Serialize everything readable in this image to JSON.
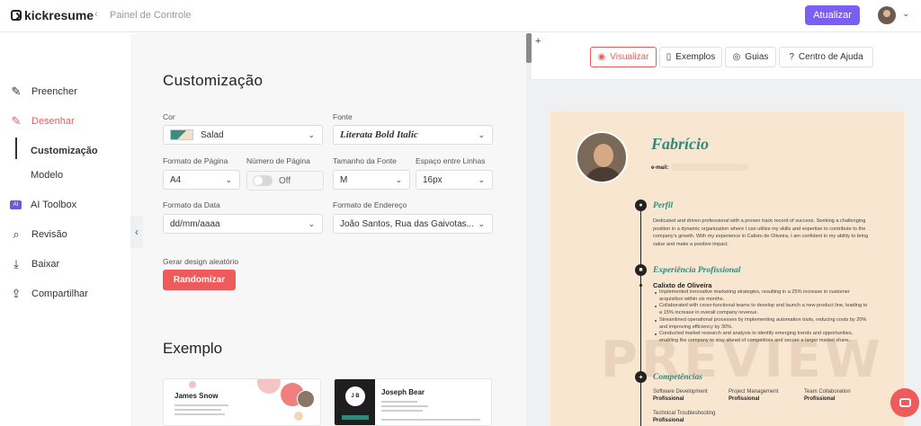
{
  "app": {
    "brand": "kickresume",
    "breadcrumb": "Painel de Controle",
    "back_icon": "chevron-left",
    "upgrade_label": "Atualizar"
  },
  "sidebar": {
    "items": [
      {
        "label": "Preencher",
        "icon": "pencil-icon"
      },
      {
        "label": "Desenhar",
        "icon": "edit-box-icon"
      },
      {
        "label": "AI Toolbox",
        "icon": "ai-badge-icon",
        "badge": "AI"
      },
      {
        "label": "Revisão",
        "icon": "review-icon"
      },
      {
        "label": "Baixar",
        "icon": "download-icon"
      },
      {
        "label": "Compartilhar",
        "icon": "share-icon"
      }
    ],
    "subitems": [
      {
        "label": "Customização"
      },
      {
        "label": "Modelo"
      }
    ]
  },
  "customize": {
    "title": "Customização",
    "color_label": "Cor",
    "color_value": "Salad",
    "font_label": "Fonte",
    "font_value": "Literata Bold Italic",
    "page_format_label": "Formato de Página",
    "page_format_value": "A4",
    "page_number_label": "Número de Página",
    "page_number_value": "Off",
    "font_size_label": "Tamanho da Fonte",
    "font_size_value": "M",
    "line_spacing_label": "Espaço entre Linhas",
    "line_spacing_value": "16px",
    "date_format_label": "Formato da Data",
    "date_format_value": "dd/mm/aaaa",
    "address_format_label": "Formato de Endereço",
    "address_format_value": "João Santos, Rua das Gaivotas...",
    "random_label": "Gerar design aleatório",
    "random_button": "Randomizar"
  },
  "examples": {
    "title": "Exemplo",
    "cards": [
      {
        "name": "James Snow"
      },
      {
        "name": "Joseph Bear",
        "monogram": "J B"
      }
    ]
  },
  "preview_tabs": [
    {
      "label": "Visualizar",
      "icon": "eye-icon",
      "active": true
    },
    {
      "label": "Exemplos",
      "icon": "book-icon"
    },
    {
      "label": "Guias",
      "icon": "target-icon"
    },
    {
      "label": "Centro de Ajuda",
      "icon": "help-icon"
    }
  ],
  "resume": {
    "name": "Fabrício",
    "email_label": "e-mail:",
    "profile_title": "Perfil",
    "profile_text": "Dedicated and driven professional with a proven track record of success. Seeking a challenging position in a dynamic organization where I can utilize my skills and expertise to contribute to the company's growth. With my experience in Calixto de Oliveira, I am confident in my ability to bring value and make a positive impact.",
    "experience_title": "Experiência Profissional",
    "job_company": "Calixto de Oliveira",
    "job_bullets": [
      "Implemented innovative marketing strategies, resulting in a 25% increase in customer acquisition within six months.",
      "Collaborated with cross-functional teams to develop and launch a new product line, leading to a 15% increase in overall company revenue.",
      "Streamlined operational processes by implementing automation tools, reducing costs by 20% and improving efficiency by 30%.",
      "Conducted market research and analysis to identify emerging trends and opportunities, enabling the company to stay ahead of competitors and secure a larger market share."
    ],
    "skills_title": "Competências",
    "skills": [
      {
        "name": "Software Development",
        "level": "Profissional"
      },
      {
        "name": "Project Management",
        "level": "Profissional"
      },
      {
        "name": "Team Collaboration",
        "level": "Profissional"
      },
      {
        "name": "Technical Troubleshooting",
        "level": "Profissional"
      }
    ],
    "watermark": "PREVIEW"
  },
  "colors": {
    "accent": "#ef5a5a",
    "upgrade": "#7b5ef2",
    "resume_accent": "#2f8a7e",
    "resume_bg": "#f9e6d0"
  }
}
